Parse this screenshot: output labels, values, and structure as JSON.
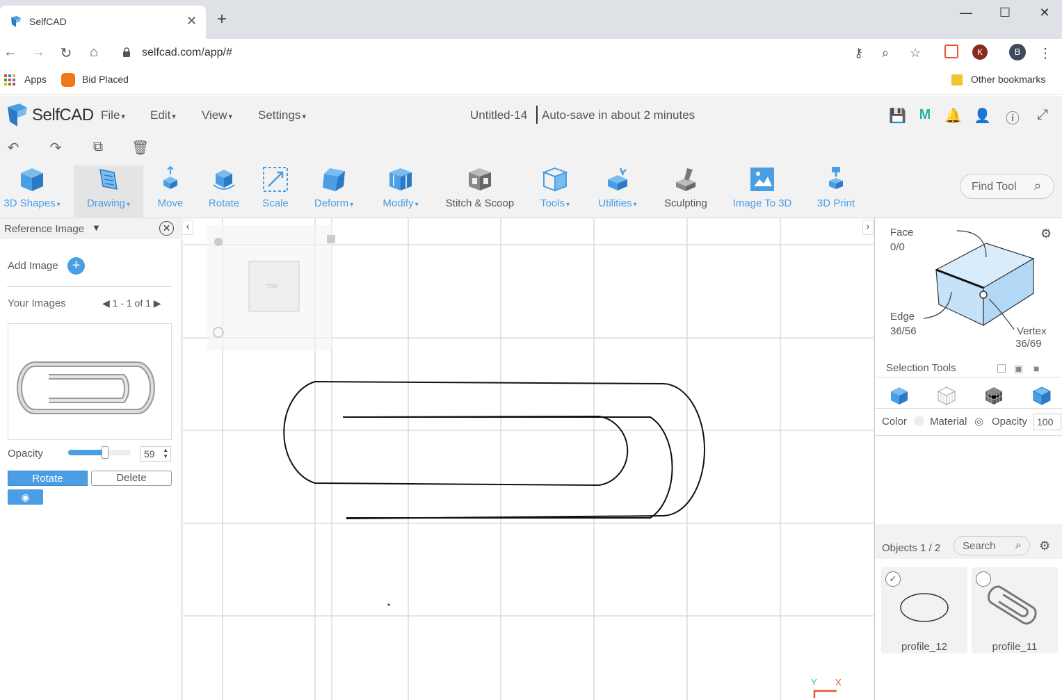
{
  "browser": {
    "tab_title": "SelfCAD",
    "url": "selfcad.com/app/#",
    "bookmarks": {
      "apps": "Apps",
      "bid_placed": "Bid Placed",
      "other": "Other bookmarks"
    },
    "profile_initial": "B",
    "extension_initial": "K"
  },
  "app": {
    "logo_text": "SelfCAD",
    "menus": [
      "File",
      "Edit",
      "View",
      "Settings"
    ],
    "doc_title": "Untitled-14",
    "autosave": "Auto-save in about 2 minutes",
    "accent_color": "#4a9ee4"
  },
  "toolbar": {
    "tools": [
      {
        "label": "3D Shapes",
        "dropdown": true
      },
      {
        "label": "Drawing",
        "dropdown": true
      },
      {
        "label": "Move",
        "dropdown": false
      },
      {
        "label": "Rotate",
        "dropdown": false
      },
      {
        "label": "Scale",
        "dropdown": false
      },
      {
        "label": "Deform",
        "dropdown": true
      },
      {
        "label": "Modify",
        "dropdown": true
      },
      {
        "label": "Stitch & Scoop",
        "dropdown": false
      },
      {
        "label": "Tools",
        "dropdown": true
      },
      {
        "label": "Utilities",
        "dropdown": true
      },
      {
        "label": "Sculpting",
        "dropdown": false
      },
      {
        "label": "Image To 3D",
        "dropdown": false
      },
      {
        "label": "3D Print",
        "dropdown": false
      }
    ],
    "find_tool_placeholder": "Find Tool"
  },
  "reference_panel": {
    "title": "Reference Image",
    "add_image": "Add Image",
    "your_images": "Your Images",
    "pager": "1 - 1 of 1",
    "opacity_label": "Opacity",
    "opacity_value": "59",
    "rotate_label": "Rotate",
    "delete_label": "Delete"
  },
  "viewport": {
    "view_cube_label": "TOP",
    "axis_y": "Y",
    "axis_x": "X"
  },
  "selection_panel": {
    "face_label": "Face",
    "face_count": "0/0",
    "edge_label": "Edge",
    "edge_count": "36/56",
    "vertex_label": "Vertex",
    "vertex_count": "36/69",
    "selection_tools": "Selection Tools",
    "color_label": "Color",
    "material_label": "Material",
    "opacity_label": "Opacity",
    "opacity_value": "100",
    "objects_label": "Objects 1 / 2",
    "search_placeholder": "Search",
    "objects": [
      {
        "name": "profile_12",
        "checked": true
      },
      {
        "name": "profile_11",
        "checked": false
      }
    ]
  }
}
